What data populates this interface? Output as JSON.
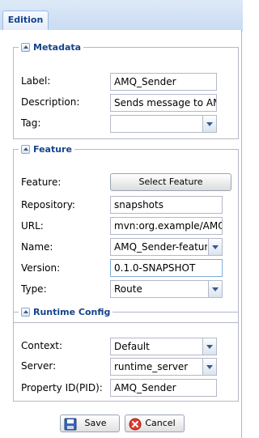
{
  "tab": {
    "label": "Edition"
  },
  "metadata": {
    "legend": "Metadata",
    "label": {
      "label": "Label:",
      "value": "AMQ_Sender"
    },
    "description": {
      "label": "Description:",
      "value": "Sends message to AMQ"
    },
    "tag": {
      "label": "Tag:",
      "value": ""
    }
  },
  "feature": {
    "legend": "Feature",
    "feature": {
      "label": "Feature:",
      "button": "Select Feature"
    },
    "repository": {
      "label": "Repository:",
      "value": "snapshots"
    },
    "url": {
      "label": "URL:",
      "value": "mvn:org.example/AMQ_"
    },
    "name": {
      "label": "Name:",
      "value": "AMQ_Sender-feature"
    },
    "version": {
      "label": "Version:",
      "value": "0.1.0-SNAPSHOT"
    },
    "type": {
      "label": "Type:",
      "value": "Route"
    }
  },
  "runtime": {
    "legend": "Runtime Config",
    "context": {
      "label": "Context:",
      "value": "Default"
    },
    "server": {
      "label": "Server:",
      "value": "runtime_server"
    },
    "pid": {
      "label": "Property ID(PID):",
      "value": "AMQ_Sender"
    }
  },
  "buttons": {
    "save": "Save",
    "cancel": "Cancel"
  },
  "icons": {
    "collapse": "collapse-icon",
    "save": "floppy-disk-icon",
    "cancel": "cancel-icon",
    "dropdown": "chevron-down-icon"
  },
  "colors": {
    "legend": "#15428b",
    "border": "#99bbe8",
    "field_border": "#b5b8c8"
  }
}
